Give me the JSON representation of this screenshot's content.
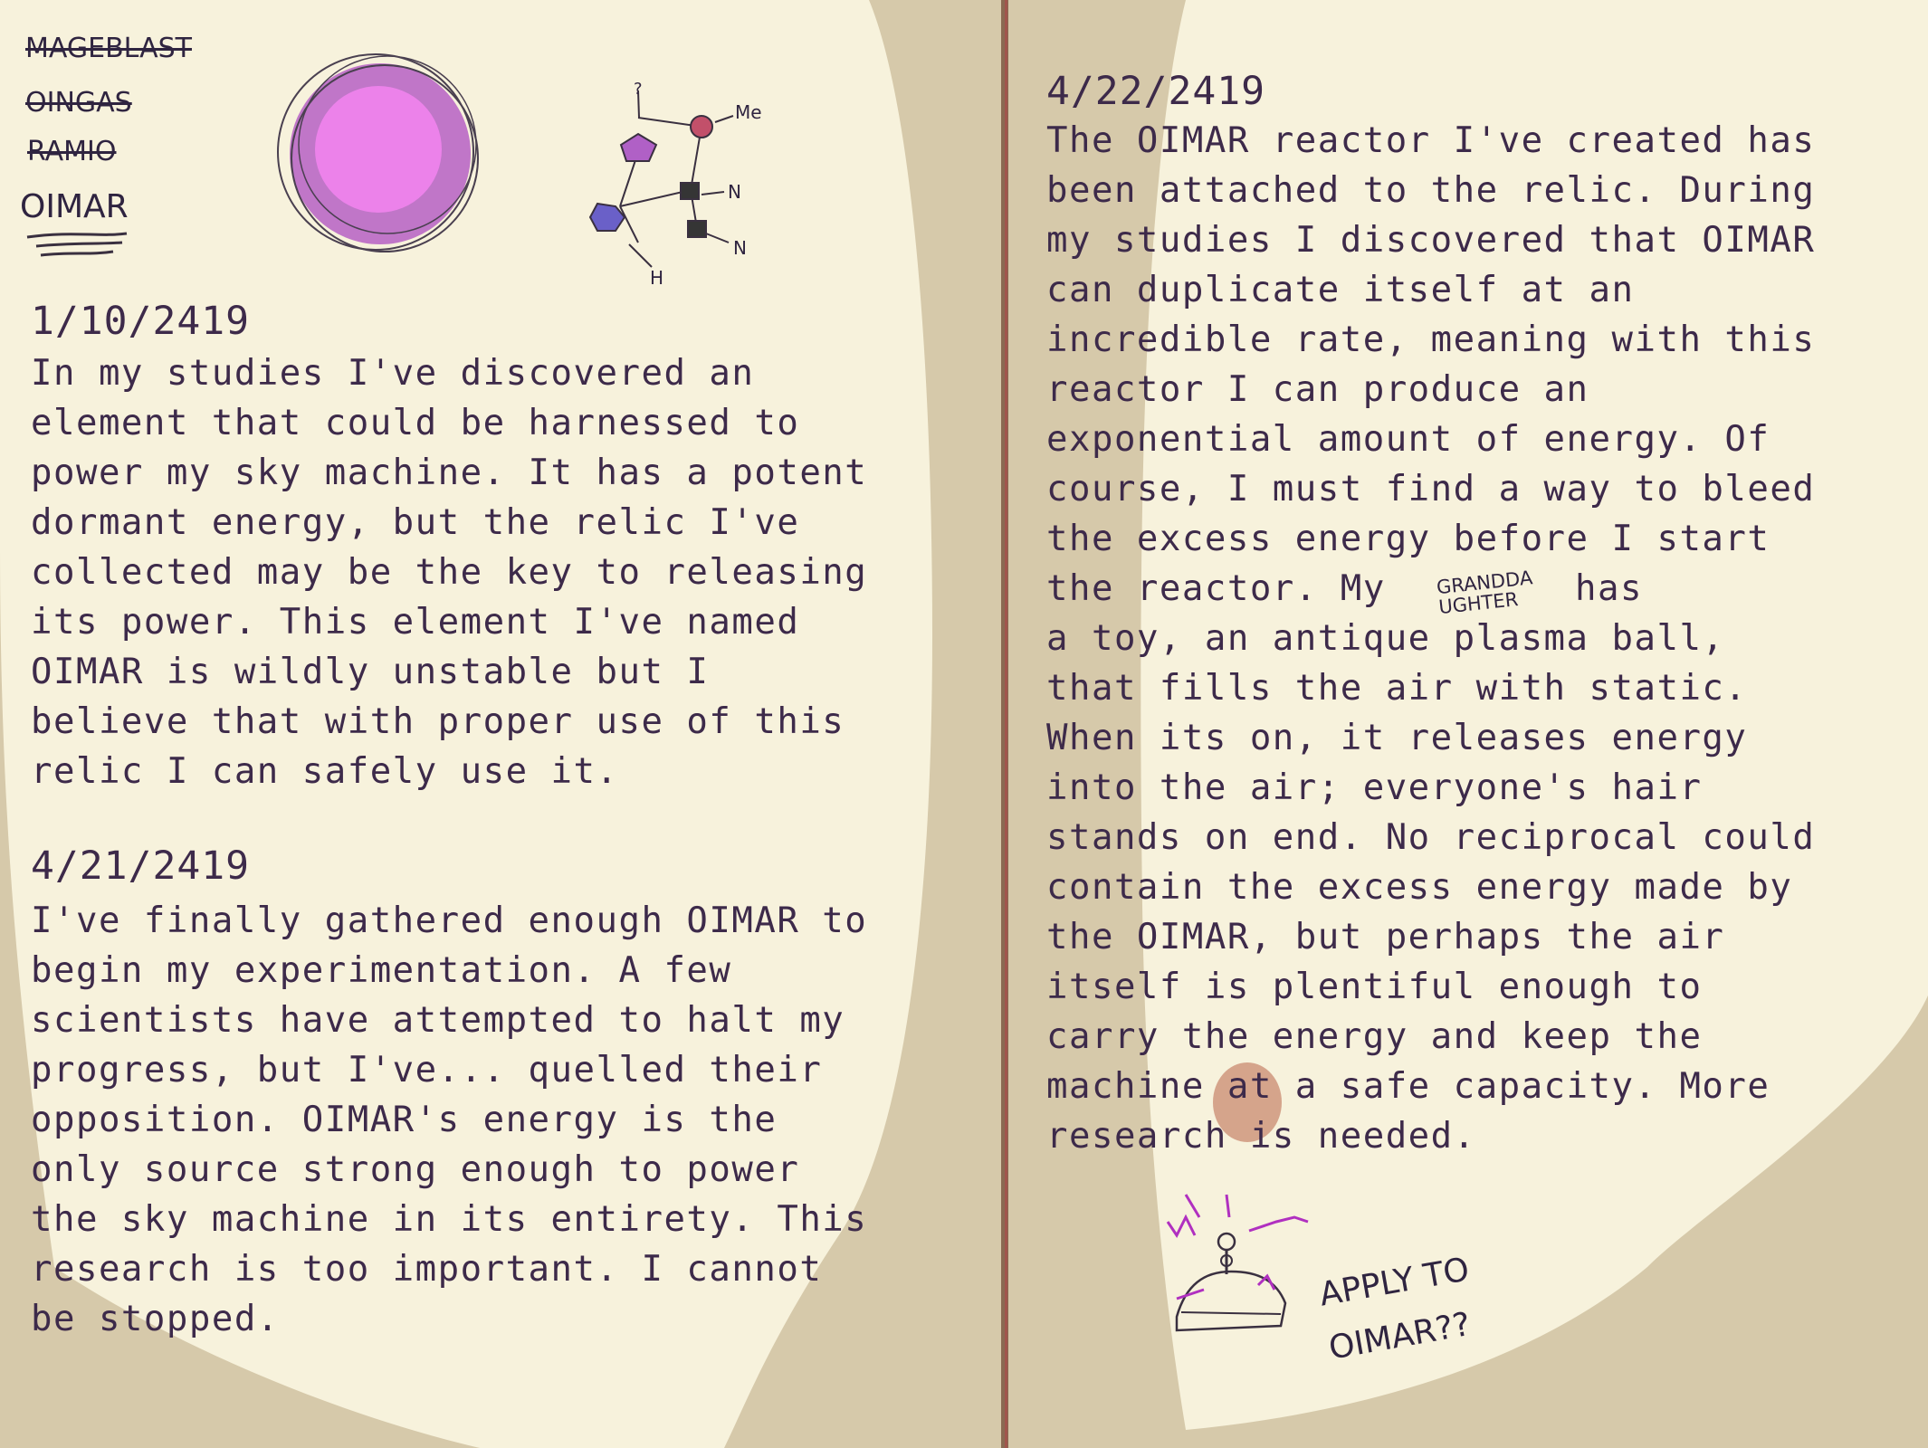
{
  "sketch_names": {
    "crossed_out": [
      "MAGEBLAST",
      "OINGAS",
      "RAMIO"
    ],
    "final": "OIMAR"
  },
  "molecule_labels": [
    "?",
    "Me",
    "N",
    "N",
    "H"
  ],
  "left_page": {
    "entries": [
      {
        "date": "1/10/2419",
        "body": "In my studies I've discovered an\nelement that could be harnessed to\npower my sky machine. It has a potent\ndormant energy, but the relic I've\ncollected may be the key to releasing\nits power. This element I've named\nOIMAR is wildly unstable but I\nbelieve that with proper use of this\nrelic I can safely use it."
      },
      {
        "date": "4/21/2419",
        "body": "I've finally gathered enough OIMAR to\nbegin my experimentation. A few\nscientists have attempted to halt my\nprogress, but I've... quelled their\nopposition. OIMAR's energy is the\nonly source strong enough to power\nthe sky machine in its entirety. This\nresearch is too important. I cannot\nbe stopped."
      }
    ]
  },
  "right_page": {
    "entry": {
      "date": "4/22/2419",
      "lines_before": "The OIMAR reactor I've created has\nbeen attached to the relic. During\nmy studies I discovered that OIMAR\ncan duplicate itself at an\nincredible rate, meaning with this\nreactor I can produce an\nexponential amount of energy. Of\ncourse, I must find a way to bleed\nthe excess energy before I start",
      "line_with_insert_start": "the reactor. My",
      "line_with_insert_end": "has",
      "inserted_word": "GRANDDAUGHTER",
      "lines_after": "a toy, an antique plasma ball,\nthat fills the air with static.\nWhen its on, it releases energy\ninto the air; everyone's hair\nstands on end. No reciprocal could\ncontain the excess energy made by\nthe OIMAR, but perhaps the air\nitself is plentiful enough to\ncarry the energy and keep the\nmachine at a safe capacity. More\nresearch is needed."
    },
    "note": "APPLY TO OIMAR??"
  },
  "colors": {
    "background": "#d6c9aa",
    "paper": "#f7f2dc",
    "ink": "#3d2a4a",
    "orb": "#e07be6",
    "spine": "#8a6a52",
    "stain": "#c98a70"
  }
}
